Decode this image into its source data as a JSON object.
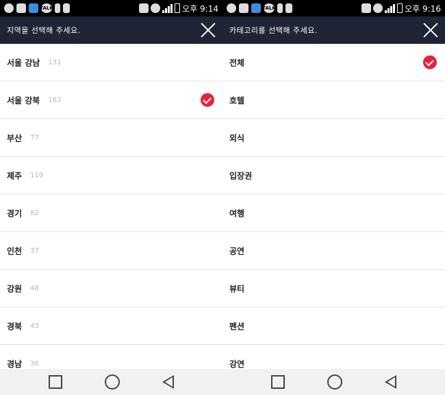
{
  "left_screen": {
    "status_time": "오후 9:14",
    "title": "지역을 선택해 주세요.",
    "regions": [
      {
        "name": "서울 강남",
        "count": "131",
        "selected": false
      },
      {
        "name": "서울 강북",
        "count": "163",
        "selected": true
      },
      {
        "name": "부산",
        "count": "77",
        "selected": false
      },
      {
        "name": "제주",
        "count": "110",
        "selected": false
      },
      {
        "name": "경기",
        "count": "82",
        "selected": false
      },
      {
        "name": "인천",
        "count": "37",
        "selected": false
      },
      {
        "name": "강원",
        "count": "48",
        "selected": false
      },
      {
        "name": "경북",
        "count": "43",
        "selected": false
      },
      {
        "name": "경남",
        "count": "36",
        "selected": false
      }
    ]
  },
  "right_screen": {
    "status_time": "오후 9:16",
    "title": "카테고리를 선택해 주세요.",
    "categories": [
      {
        "name": "전체",
        "selected": true
      },
      {
        "name": "호텔",
        "selected": false
      },
      {
        "name": "외식",
        "selected": false
      },
      {
        "name": "입장권",
        "selected": false
      },
      {
        "name": "여행",
        "selected": false
      },
      {
        "name": "공연",
        "selected": false
      },
      {
        "name": "뷰티",
        "selected": false
      },
      {
        "name": "펜션",
        "selected": false
      },
      {
        "name": "강연",
        "selected": false
      }
    ]
  },
  "colors": {
    "header_bg": "#1f2536",
    "check_red": "#e8223c"
  },
  "status_icons": [
    "lg-icon",
    "image-icon",
    "app-icon",
    "talk-icon",
    "usb-icon",
    "android-icon",
    "nfc-icon",
    "mute-icon",
    "wifi-icon",
    "signal-icon",
    "battery-icon"
  ]
}
